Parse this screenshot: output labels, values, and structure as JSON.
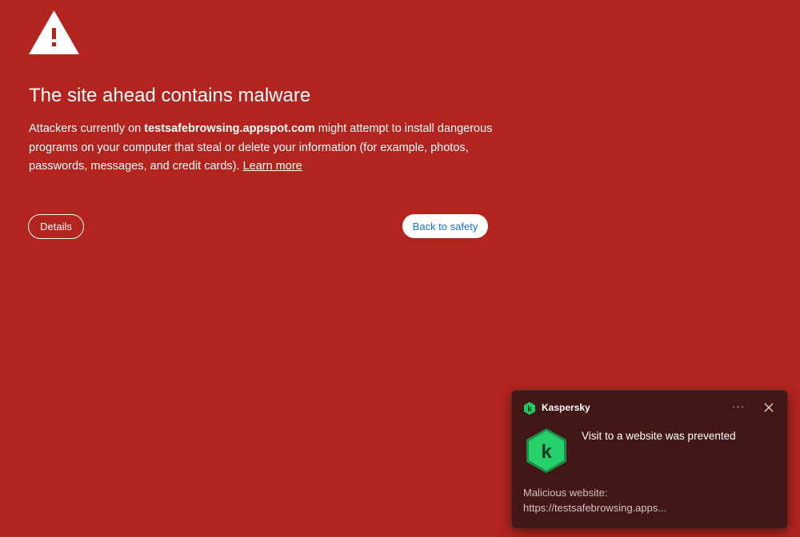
{
  "interstitial": {
    "title": "The site ahead contains malware",
    "message_before": "Attackers currently on ",
    "site_name": "testsafebrowsing.appspot.com",
    "message_after": " might attempt to install dangerous programs on your computer that steal or delete your information (for example, photos, passwords, messages, and credit cards). ",
    "learn_more_label": "Learn more",
    "details_label": "Details",
    "back_label": "Back to safety",
    "warning_icon": "warning-triangle-icon"
  },
  "toast": {
    "app_name": "Kaspersky",
    "app_icon": "kaspersky-k-icon",
    "more_label": "···",
    "heading": "Visit to a website was prevented",
    "detail_label": "Malicious website:",
    "detail_url": "https://testsafebrowsing.apps..."
  },
  "colors": {
    "background": "#b3241f",
    "toast_background": "#421716",
    "back_button_text": "#1a73e8",
    "kaspersky_green": "#1fcb62"
  }
}
